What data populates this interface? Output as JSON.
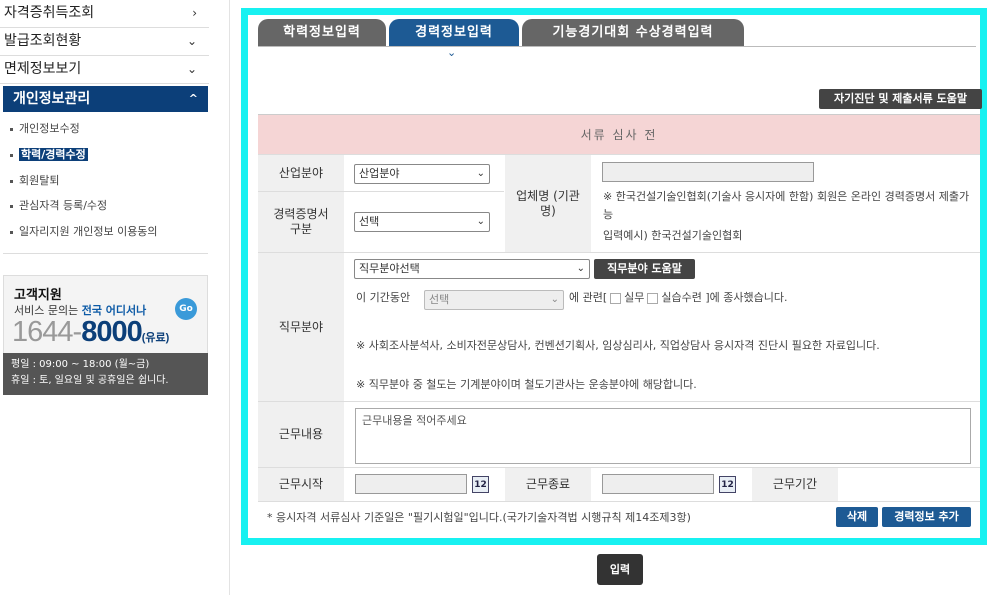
{
  "sidebar": {
    "nav": [
      {
        "label": "자격증취득조회",
        "chevron": "›"
      },
      {
        "label": "발급조회현황",
        "chevron": "⌄"
      },
      {
        "label": "면제정보보기",
        "chevron": "⌄"
      }
    ],
    "personal": {
      "label": "개인정보관리",
      "chevron": "^",
      "items": [
        {
          "label": "개인정보수정"
        },
        {
          "label": "학력/경력수정",
          "active": true
        },
        {
          "label": "회원탈퇴"
        },
        {
          "label": "관심자격 등록/수정"
        },
        {
          "label": "일자리지원 개인정보 이용동의"
        }
      ]
    },
    "support": {
      "title": "고객지원",
      "desc_prefix": "서비스 문의는",
      "desc_highlight": "전국 어디서나",
      "go": "Go",
      "phone_prefix": "1644",
      "phone_dash": "-",
      "phone_main": "8000",
      "fee": "(유료)",
      "hours_line1": "평일 : 09:00 ~ 18:00 (월~금)",
      "hours_line2": "휴일 : 토, 일요일 및 공휴일은 쉽니다."
    }
  },
  "tabs": [
    {
      "label": "학력정보입력",
      "active": false
    },
    {
      "label": "경력정보입력",
      "active": true
    },
    {
      "label": "기능경기대회 수상경력입력",
      "active": false
    }
  ],
  "help_button": "자기진단 및 제출서류 도움말",
  "status_text": "서류 심사 전",
  "form": {
    "industry_label": "산업분야",
    "industry_select": "산업분야",
    "cert_label": "경력증명서 구분",
    "cert_select": "선택",
    "company_label": "업체명 (기관명)",
    "company_note": "※ 한국건설기술인협회(기술사 응시자에 한함) 회원은 온라인 경력증명서 제출가능",
    "company_example": "입력예시) 한국건설기술인협회",
    "job_label": "직무분야",
    "job_select": "직무분야선택",
    "job_help": "직무분야 도움말",
    "period_prefix": "이 기간동안",
    "period_select": "선택",
    "period_mid": "에 관련[",
    "chk1": "실무",
    "chk2": "실습수련",
    "period_suffix": "]에 종사했습니다.",
    "note1": "※ 사회조사분석사, 소비자전문상담사, 컨벤션기획사, 임상심리사, 직업상담사 응시자격 진단시 필요한 자료입니다.",
    "note2": "※ 직무분야 중 철도는 기계분야이며 철도기관사는 운송분야에 해당합니다.",
    "work_label": "근무내용",
    "work_placeholder": "근무내용을 적어주세요",
    "start_label": "근무시작",
    "end_label": "근무종료",
    "period_label": "근무기간",
    "cal_icon": "12"
  },
  "footnote": "* 응시자격 서류심사 기준일은 \"필기시험일\"입니다.(국가기술자격법 시행규칙 제14조제3항)",
  "delete_button": "삭제",
  "add_button": "경력정보 추가",
  "submit_button": "입력"
}
